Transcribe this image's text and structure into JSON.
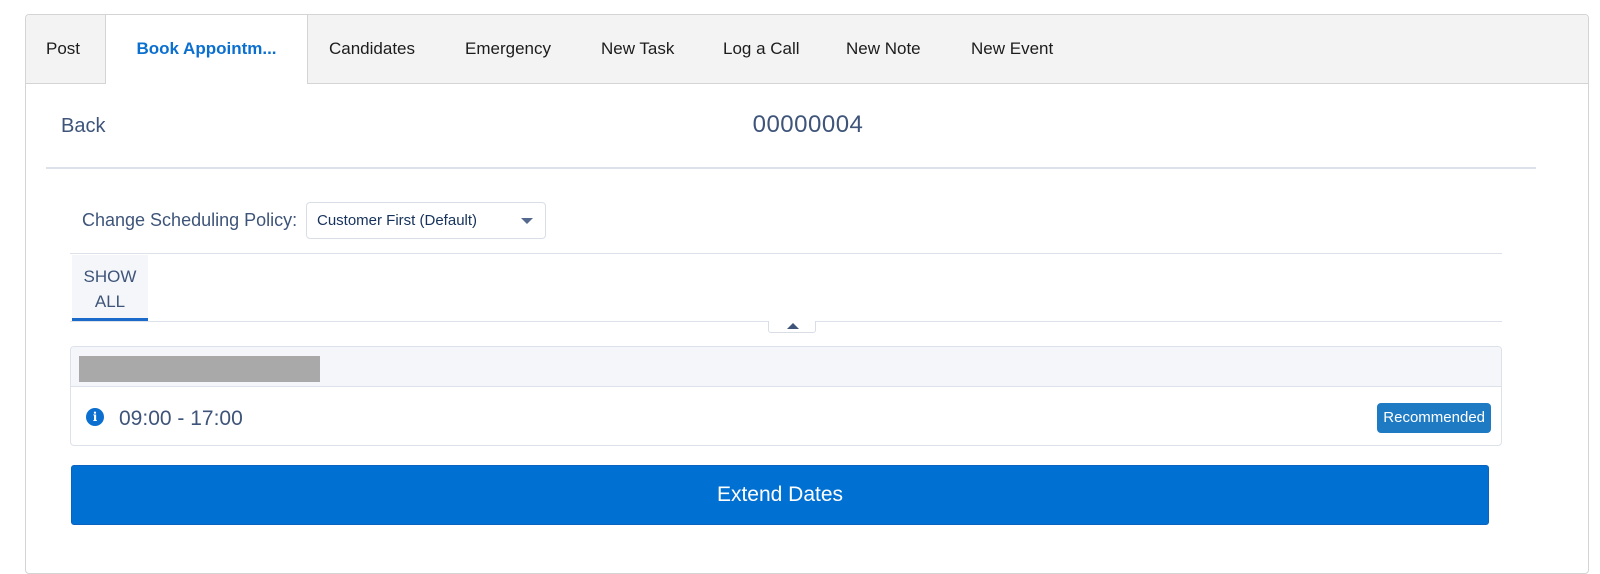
{
  "tabs": [
    {
      "label": "Post",
      "active": false
    },
    {
      "label": "Book Appointm...",
      "active": true
    },
    {
      "label": "Candidates",
      "active": false
    },
    {
      "label": "Emergency",
      "active": false
    },
    {
      "label": "New Task",
      "active": false
    },
    {
      "label": "Log a Call",
      "active": false
    },
    {
      "label": "New Note",
      "active": false
    },
    {
      "label": "New Event",
      "active": false
    }
  ],
  "header": {
    "back_label": "Back",
    "record_number": "00000004"
  },
  "policy": {
    "label": "Change Scheduling Policy:",
    "selected": "Customer First (Default)"
  },
  "filter": {
    "show_all_line1": "SHOW",
    "show_all_line2": "ALL"
  },
  "slots": [
    {
      "time_range": "09:00 - 17:00",
      "badge": "Recommended",
      "icon": "info-icon"
    }
  ],
  "actions": {
    "extend_dates_label": "Extend Dates"
  },
  "colors": {
    "accent": "#0070d2",
    "active_tab_text": "#0b6fcf",
    "badge": "#1f7ac4",
    "text": "#3e5479"
  }
}
